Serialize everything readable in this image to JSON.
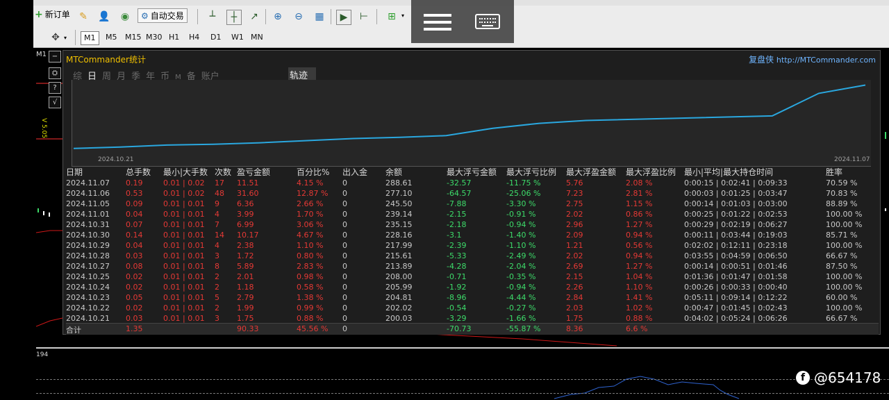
{
  "toolbar": {
    "new_order": "新订单",
    "auto_trade": "自动交易"
  },
  "timeframes": [
    "M1",
    "M5",
    "M15",
    "M30",
    "H1",
    "H4",
    "D1",
    "W1",
    "MN"
  ],
  "chart": {
    "tf_label": "M1",
    "v_label": "V 5.05",
    "sub_label": "194"
  },
  "panel": {
    "title": "MTCommander统计",
    "brand_cn": "复盘侠",
    "brand_url": "http://MTCommander.com",
    "tabs": [
      "综",
      "日",
      "周",
      "月",
      "季",
      "年",
      "币",
      "M",
      "备",
      "账户"
    ],
    "active_tab": "日",
    "track_tab": "轨迹",
    "x_start": "2024.10.21",
    "x_end": "2024.11.07"
  },
  "columns": [
    "日期",
    "总手数",
    "最小|大手数",
    "次数",
    "盈亏金额",
    "百分比%",
    "出入金",
    "余额",
    "最大浮亏金额",
    "最大浮亏比例",
    "最大浮盈金额",
    "最大浮盈比例",
    "最小|平均|最大持仓时间",
    "胜率"
  ],
  "rows": [
    [
      "2024.11.07",
      "0.19",
      "0.01 | 0.02",
      "17",
      "11.51",
      "4.15 %",
      "0",
      "288.61",
      "-32.57",
      "-11.75 %",
      "5.76",
      "2.08 %",
      "0:00:15 | 0:02:41 | 0:09:33",
      "70.59 %"
    ],
    [
      "2024.11.06",
      "0.53",
      "0.01 | 0.02",
      "48",
      "31.60",
      "12.87 %",
      "0",
      "277.10",
      "-64.57",
      "-25.06 %",
      "7.23",
      "2.81 %",
      "0:00:03 | 0:01:25 | 0:03:47",
      "70.83 %"
    ],
    [
      "2024.11.05",
      "0.09",
      "0.01 | 0.01",
      "9",
      "6.36",
      "2.66 %",
      "0",
      "245.50",
      "-7.88",
      "-3.30 %",
      "2.75",
      "1.15 %",
      "0:00:14 | 0:01:03 | 0:03:00",
      "88.89 %"
    ],
    [
      "2024.11.01",
      "0.04",
      "0.01 | 0.01",
      "4",
      "3.99",
      "1.70 %",
      "0",
      "239.14",
      "-2.15",
      "-0.91 %",
      "2.02",
      "0.86 %",
      "0:00:25 | 0:01:22 | 0:02:53",
      "100.00 %"
    ],
    [
      "2024.10.31",
      "0.07",
      "0.01 | 0.01",
      "7",
      "6.99",
      "3.06 %",
      "0",
      "235.15",
      "-2.18",
      "-0.94 %",
      "2.96",
      "1.27 %",
      "0:00:29 | 0:02:19 | 0:06:27",
      "100.00 %"
    ],
    [
      "2024.10.30",
      "0.14",
      "0.01 | 0.01",
      "14",
      "10.17",
      "4.67 %",
      "0",
      "228.16",
      "-3.1",
      "-1.40 %",
      "2.09",
      "0.94 %",
      "0:00:11 | 0:03:44 | 0:19:03",
      "85.71 %"
    ],
    [
      "2024.10.29",
      "0.04",
      "0.01 | 0.01",
      "4",
      "2.38",
      "1.10 %",
      "0",
      "217.99",
      "-2.39",
      "-1.10 %",
      "1.21",
      "0.56 %",
      "0:02:02 | 0:12:11 | 0:23:18",
      "100.00 %"
    ],
    [
      "2024.10.28",
      "0.03",
      "0.01 | 0.01",
      "3",
      "1.72",
      "0.80 %",
      "0",
      "215.61",
      "-5.33",
      "-2.49 %",
      "2.02",
      "0.94 %",
      "0:03:55 | 0:04:59 | 0:06:50",
      "66.67 %"
    ],
    [
      "2024.10.27",
      "0.08",
      "0.01 | 0.01",
      "8",
      "5.89",
      "2.83 %",
      "0",
      "213.89",
      "-4.28",
      "-2.04 %",
      "2.69",
      "1.27 %",
      "0:00:14 | 0:00:51 | 0:01:46",
      "87.50 %"
    ],
    [
      "2024.10.25",
      "0.02",
      "0.01 | 0.01",
      "2",
      "2.01",
      "0.98 %",
      "0",
      "208.00",
      "-0.71",
      "-0.35 %",
      "2.15",
      "1.04 %",
      "0:01:36 | 0:01:47 | 0:01:58",
      "100.00 %"
    ],
    [
      "2024.10.24",
      "0.02",
      "0.01 | 0.01",
      "2",
      "1.18",
      "0.58 %",
      "0",
      "205.99",
      "-1.92",
      "-0.94 %",
      "2.26",
      "1.10 %",
      "0:00:26 | 0:00:33 | 0:00:40",
      "100.00 %"
    ],
    [
      "2024.10.23",
      "0.05",
      "0.01 | 0.01",
      "5",
      "2.79",
      "1.38 %",
      "0",
      "204.81",
      "-8.96",
      "-4.44 %",
      "2.84",
      "1.41 %",
      "0:05:11 | 0:09:14 | 0:12:22",
      "60.00 %"
    ],
    [
      "2024.10.22",
      "0.02",
      "0.01 | 0.01",
      "2",
      "1.99",
      "0.99 %",
      "0",
      "202.02",
      "-0.54",
      "-0.27 %",
      "2.03",
      "1.02 %",
      "0:00:47 | 0:01:45 | 0:02:43",
      "100.00 %"
    ],
    [
      "2024.10.21",
      "0.03",
      "0.01 | 0.01",
      "3",
      "1.75",
      "0.88 %",
      "0",
      "200.03",
      "-3.29",
      "-1.66 %",
      "1.75",
      "0.88 %",
      "0:04:02 | 0:05:24 | 0:06:26",
      "66.67 %"
    ]
  ],
  "total": {
    "label": "合计",
    "lots": "1.35",
    "pnl": "90.33",
    "pct": "45.56 %",
    "inout": "0",
    "max_loss": "-70.73",
    "max_loss_pct": "-55.87 %",
    "max_gain": "8.36",
    "max_gain_pct": "6.6 %"
  },
  "equity_curve": [
    200.03,
    202.02,
    204.81,
    205.99,
    208.0,
    213.89,
    215.61,
    217.99,
    228.16,
    235.15,
    239.14,
    245.5,
    277.1,
    288.61
  ],
  "watermark": "@654178"
}
